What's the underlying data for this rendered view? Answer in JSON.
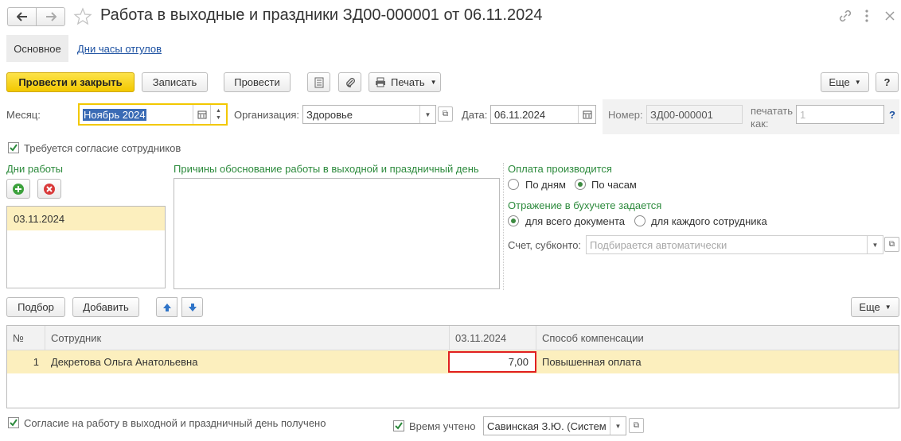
{
  "window": {
    "title": "Работа в выходные и праздники ЗД00-000001 от 06.11.2024"
  },
  "tabs": {
    "main": "Основное",
    "days": "Дни часы отгулов"
  },
  "toolbar": {
    "post_close": "Провести и закрыть",
    "save": "Записать",
    "post": "Провести",
    "print": "Печать",
    "more": "Еще",
    "help": "?"
  },
  "header": {
    "month_label": "Месяц:",
    "month_value": "Ноябрь 2024",
    "org_label": "Организация:",
    "org_value": "Здоровье",
    "date_label": "Дата:",
    "date_value": "06.11.2024",
    "number_label": "Номер:",
    "number_value": "ЗД00-000001",
    "print_as_label_1": "печатать",
    "print_as_label_2": "как:",
    "print_as_value": "1",
    "help_q": "?"
  },
  "consent_required": {
    "label": "Требуется согласие сотрудников",
    "checked": true
  },
  "work_days": {
    "title": "Дни работы",
    "items": [
      "03.11.2024"
    ]
  },
  "reasons": {
    "title": "Причины обоснование работы в выходной и праздничный день",
    "value": ""
  },
  "payment": {
    "title": "Оплата производится",
    "by_days": "По дням",
    "by_hours": "По часам",
    "selected": "По часам"
  },
  "accounting": {
    "title": "Отражение в бухучете задается",
    "whole_doc": "для всего документа",
    "each_employee": "для каждого сотрудника",
    "selected": "для всего документа",
    "account_label": "Счет, субконто:",
    "account_placeholder": "Подбирается автоматически"
  },
  "table_toolbar": {
    "pick": "Подбор",
    "add": "Добавить",
    "more": "Еще"
  },
  "table": {
    "columns": [
      "№",
      "Сотрудник",
      "03.11.2024",
      "Способ компенсации"
    ],
    "rows": [
      {
        "num": "1",
        "employee": "Декретова Ольга Анатольевна",
        "hours": "7,00",
        "compensation": "Повышенная оплата"
      }
    ]
  },
  "footer": {
    "consent_received": "Согласие на работу в выходной и праздничный день получено",
    "time_accounted": "Время учтено",
    "time_accounted_by": "Савинская З.Ю. (Систем"
  },
  "colors": {
    "accent_green": "#2c8a3c",
    "primary_yellow": "#f2c800",
    "row_highlight": "#fcefbe",
    "cell_outline": "#e02020",
    "link_blue": "#1a4fa0"
  }
}
